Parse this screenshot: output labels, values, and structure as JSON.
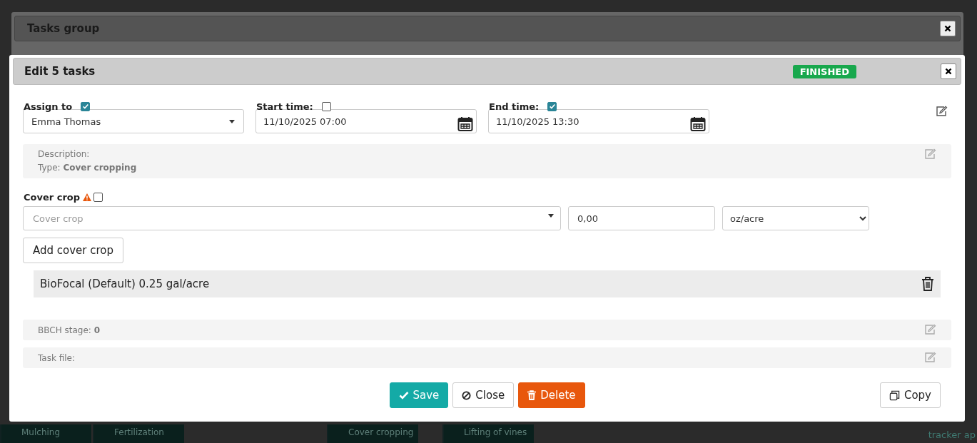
{
  "background": {
    "tiles": [
      {
        "label": "Mulching"
      },
      {
        "label": "Fertilization"
      },
      {
        "label": "Cover cropping"
      },
      {
        "label": "Lifting of vines"
      }
    ],
    "side_lines": [
      "tracker ap"
    ]
  },
  "tasks_group": {
    "title": "Tasks group"
  },
  "edit_dialog": {
    "title": "Edit 5 tasks",
    "status": "FINISHED",
    "fields": [
      {
        "kind": "select",
        "label": "Assign to",
        "checked": true,
        "value": "Emma Thomas"
      },
      {
        "kind": "datetime",
        "label": "Start time:",
        "checked": false,
        "value": "11/10/2025 07:00"
      },
      {
        "kind": "datetime",
        "label": "End time:",
        "checked": true,
        "value": "11/10/2025 13:30"
      }
    ],
    "description": {
      "label": "Description:",
      "type_label": "Type:",
      "type_value": "Cover cropping"
    },
    "cover_crop": {
      "label": "Cover crop",
      "checked": false,
      "placeholder": "Cover crop",
      "amount": "0,00",
      "unit": "oz/acre",
      "add_button": "Add cover crop"
    },
    "items": [
      {
        "text": "BioFocal (Default) 0.25 gal/acre"
      }
    ],
    "bbch": {
      "label": "BBCH stage:",
      "value": "0"
    },
    "task_file": {
      "label": "Task file:"
    },
    "buttons": [
      {
        "kind": "save",
        "label": "Save"
      },
      {
        "kind": "close",
        "label": "Close"
      },
      {
        "kind": "delete",
        "label": "Delete"
      }
    ],
    "copy_button": "Copy"
  }
}
